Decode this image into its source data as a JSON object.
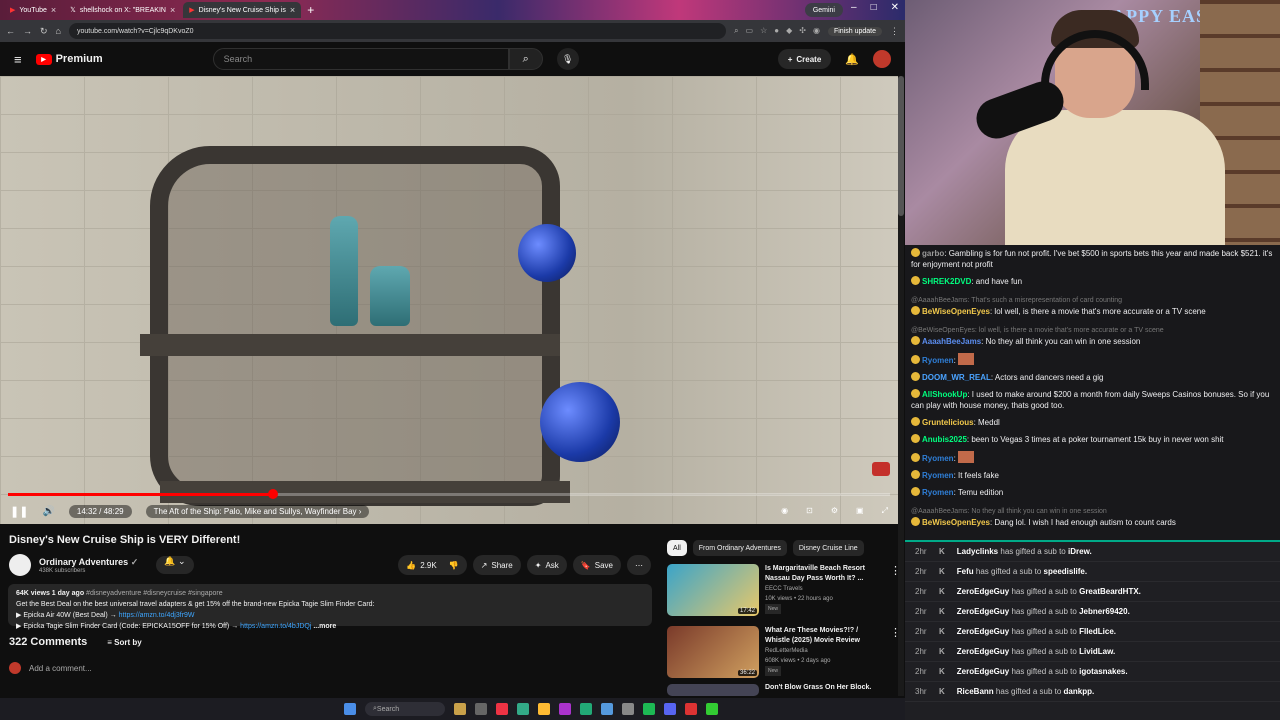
{
  "browser": {
    "tabs": [
      {
        "label": "YouTube"
      },
      {
        "label": "shellshock on X: \"BREAKIN"
      },
      {
        "label": "Disney's New Cruise Ship is"
      }
    ],
    "gemini": "Gemini",
    "url": "youtube.com/watch?v=Cjlc9qDKvoZ0",
    "update": "Finish update"
  },
  "yt": {
    "brand": "Premium",
    "search_placeholder": "Search",
    "create": "Create"
  },
  "player": {
    "time": "14:32 / 48:29",
    "chapter": "The Aft of the Ship: Palo, Mike and Sullys, Wayfinder Bay",
    "progress": 0.3
  },
  "video": {
    "title": "Disney's New Cruise Ship is VERY Different!",
    "channel": "Ordinary Adventures",
    "subscribers": "438K subscribers",
    "likes": "2.9K",
    "share": "Share",
    "ask": "Ask",
    "save": "Save",
    "desc_meta": "64K views  1 day ago",
    "desc_tags": "#disneyadventure #disneycruise #singapore",
    "desc_line1": "Get the Best Deal on the best universal travel adapters & get 15% off the brand-new Epicka Tagie Slim Finder Card:",
    "desc_line2": "▶ Epicka Air 40W (Best Deal) →",
    "desc_link2": "https://amzn.to/4dj3fr9W",
    "desc_line3": "▶ Epicka Tagie Slim Finder Card (Code: EPICKA15OFF for 15% Off) →",
    "desc_link3": "https://amzn.to/4bJDQj",
    "more": "...more",
    "comments": "322 Comments",
    "sort": "Sort by",
    "add_comment": "Add a comment..."
  },
  "side": {
    "chips": [
      "All",
      "From Ordinary Adventures",
      "Disney Cruise Line"
    ],
    "recs": [
      {
        "title": "Is Margaritaville Beach Resort Nassau Day Pass Worth It? ...",
        "channel": "EECC Travels",
        "meta": "10K views • 22 hours ago",
        "badge": "New",
        "duration": "17:42",
        "color": "#3aa4c9"
      },
      {
        "title": "What Are These Movies?!? / Whistle (2025) Movie Review",
        "channel": "RedLetterMedia",
        "meta": "608K views • 2 days ago",
        "badge": "New",
        "duration": "36:22",
        "color": "#7a3a2a"
      },
      {
        "title": "Don't Blow Grass On Her Block.",
        "channel": "",
        "meta": "",
        "badge": "",
        "duration": "",
        "color": "#445"
      }
    ]
  },
  "stream": {
    "banner": "HAPPY EAST"
  },
  "chat": [
    {
      "user": "garbo",
      "color": "#9b9b9b",
      "text": "Gambling is for fun not profit. I've bet $500 in sports bets this year and made back $521. it's for enjoyment not profit",
      "reply": ""
    },
    {
      "user": "SHREK2DVD",
      "color": "#00ff7f",
      "text": "and have fun",
      "reply": ""
    },
    {
      "user": "BeWiseOpenEyes",
      "color": "#f2c94c",
      "text": "lol well, is there a movie that's more accurate or a TV scene",
      "reply": "@AaaahBeeJams: That's such a misrepresentation of card counting"
    },
    {
      "user": "AaaahBeeJams",
      "color": "#5b8def",
      "text": "No they all think you can win in one session",
      "reply": "@BeWiseOpenEyes: lol well, is there a movie that's more accurate or a TV scene"
    },
    {
      "user": "Ryomen",
      "color": "#2f7fd8",
      "text": "",
      "reply": ""
    },
    {
      "user": "DOOM_WR_REAL",
      "color": "#4aa3ff",
      "text": "Actors and dancers need a gig",
      "reply": ""
    },
    {
      "user": "AllShookUp",
      "color": "#00ff7f",
      "text": "I used to make around $200 a month from daily Sweeps Casinos bonuses. So if you can play with house money, thats good too.",
      "reply": ""
    },
    {
      "user": "Gruntelicious",
      "color": "#f2c94c",
      "text": "Meddl",
      "reply": ""
    },
    {
      "user": "Anubis2025",
      "color": "#00ff7f",
      "text": "been to Vegas 3 times at a poker tournament 15k buy in never won shit",
      "reply": ""
    },
    {
      "user": "Ryomen",
      "color": "#2f7fd8",
      "text": "",
      "reply": ""
    },
    {
      "user": "Ryomen",
      "color": "#2f7fd8",
      "text": "It feels fake",
      "reply": ""
    },
    {
      "user": "Ryomen",
      "color": "#2f7fd8",
      "text": "Temu edition",
      "reply": ""
    },
    {
      "user": "BeWiseOpenEyes",
      "color": "#f2c94c",
      "text": "Dang lol. I wish I had enough autism to count cards",
      "reply": "@AaaahBeeJams: No they all think you can win in one session"
    }
  ],
  "subs": [
    {
      "time": "2hr",
      "user": "Ladyclinks",
      "target": "iDrew."
    },
    {
      "time": "2hr",
      "user": "Fefu",
      "target": "speedislife."
    },
    {
      "time": "2hr",
      "user": "ZeroEdgeGuy",
      "target": "GreatBeardHTX."
    },
    {
      "time": "2hr",
      "user": "ZeroEdgeGuy",
      "target": "Jebner69420."
    },
    {
      "time": "2hr",
      "user": "ZeroEdgeGuy",
      "target": "FlledLice."
    },
    {
      "time": "2hr",
      "user": "ZeroEdgeGuy",
      "target": "LividLaw."
    },
    {
      "time": "2hr",
      "user": "ZeroEdgeGuy",
      "target": "igotasnakes."
    },
    {
      "time": "3hr",
      "user": "RiceBann",
      "target": "dankpp."
    }
  ],
  "sub_verb": "has gifted a sub to",
  "taskbar": {
    "search": "Search"
  }
}
